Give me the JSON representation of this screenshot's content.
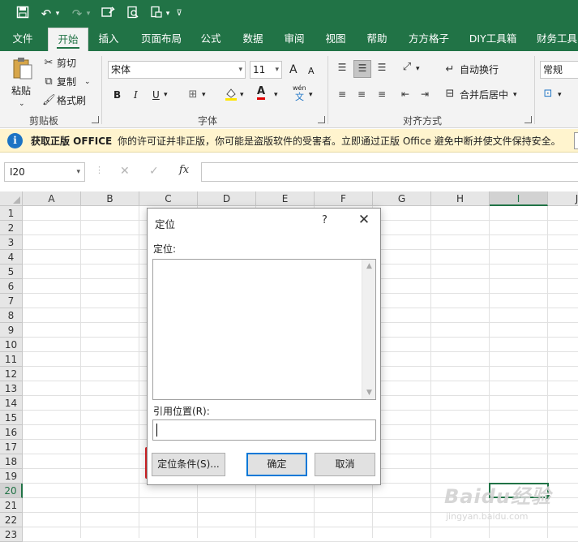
{
  "qat": {
    "icons": [
      "save-icon",
      "undo-icon",
      "redo-icon",
      "touch-mode-icon",
      "print-preview-icon",
      "print-icon",
      "customize-icon"
    ]
  },
  "tabs": [
    "文件",
    "开始",
    "插入",
    "页面布局",
    "公式",
    "数据",
    "审阅",
    "视图",
    "帮助",
    "方方格子",
    "DIY工具箱",
    "财务工具"
  ],
  "active_tab": "开始",
  "ribbon": {
    "clipboard": {
      "paste": "粘贴",
      "cut": "剪切",
      "copy": "复制",
      "format_painter": "格式刷",
      "label": "剪贴板"
    },
    "font": {
      "font_name": "宋体",
      "font_size": "11",
      "grow": "A",
      "shrink": "A",
      "bold": "B",
      "italic": "I",
      "underline": "U",
      "font_color": "A",
      "phonetic_top": "wén",
      "phonetic_bottom": "文",
      "label": "字体"
    },
    "alignment": {
      "wrap_text": "自动换行",
      "merge_center": "合并后居中",
      "label": "对齐方式"
    },
    "number": {
      "format": "常规"
    }
  },
  "infobar": {
    "title": "获取正版 OFFICE",
    "message": "你的许可证并非正版，你可能是盗版软件的受害者。立即通过正版 Office 避免中断并使文件保持安全。"
  },
  "formula_bar": {
    "name_box": "I20",
    "fx": "fx",
    "formula": ""
  },
  "grid": {
    "columns": [
      "A",
      "B",
      "C",
      "D",
      "E",
      "F",
      "G",
      "H",
      "I",
      "J"
    ],
    "rows": [
      "1",
      "2",
      "3",
      "4",
      "5",
      "6",
      "7",
      "8",
      "9",
      "10",
      "11",
      "12",
      "13",
      "14",
      "15",
      "16",
      "17",
      "18",
      "19",
      "20",
      "21",
      "22",
      "23"
    ],
    "selected_column": "I",
    "selected_row": "20"
  },
  "dialog": {
    "title": "定位",
    "help": "?",
    "close": "✕",
    "goto_label": "定位:",
    "ref_label": "引用位置(R):",
    "ref_value": "",
    "special_button": "定位条件(S)...",
    "ok_button": "确定",
    "cancel_button": "取消"
  },
  "watermark": {
    "logo": "Baidu经验",
    "sub": "jingyan.baidu.com"
  },
  "colors": {
    "excel_green": "#217346",
    "highlight_red": "#e0262a",
    "info_blue": "#1c73c4",
    "info_bg": "#fff4ce"
  }
}
